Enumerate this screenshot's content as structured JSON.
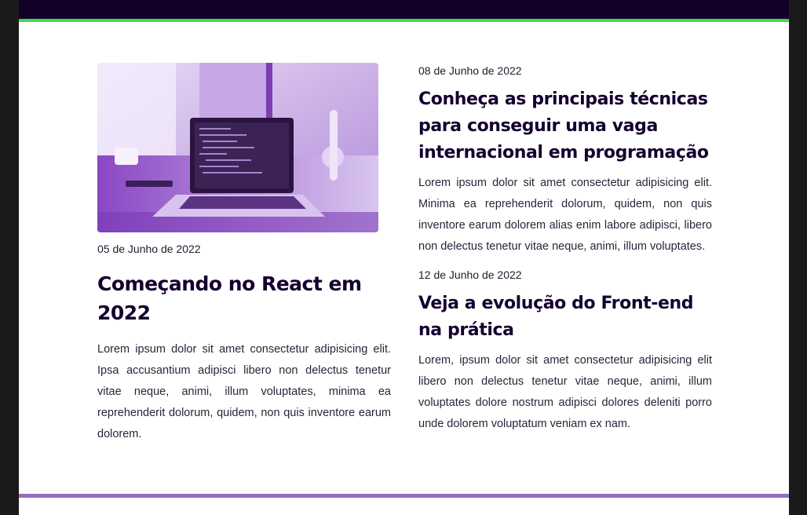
{
  "posts": [
    {
      "date": "05 de Junho de 2022",
      "title": "Começando no React em 2022",
      "excerpt": "Lorem ipsum dolor sit amet consectetur adipisicing elit. Ipsa accusantium adipisci libero non delectus tenetur vitae neque, animi, illum voluptates, minima ea reprehenderit dolorum, quidem, non quis inventore earum dolorem."
    },
    {
      "date": "08 de Junho de 2022",
      "title": "Conheça as principais técnicas para conseguir uma vaga internacional em programação",
      "excerpt": "Lorem ipsum dolor sit amet consectetur adipisicing elit. Minima ea reprehenderit dolorum, quidem, non quis inventore earum dolorem alias enim labore adipisci, libero non delectus tenetur vitae neque, animi, illum voluptates."
    },
    {
      "date": "12 de Junho de 2022",
      "title": "Veja a evolução do Front-end na prática",
      "excerpt": "Lorem, ipsum dolor sit amet consectetur adipisicing elit libero non delectus tenetur vitae neque, animi, illum voluptates dolore nostrum adipisci dolores deleniti porro unde dolorem voluptatum veniam ex nam."
    }
  ],
  "colors": {
    "header": "#12002a",
    "accent_green": "#42d84a",
    "accent_purple": "#9a6cbf",
    "title_text": "#14002e"
  }
}
